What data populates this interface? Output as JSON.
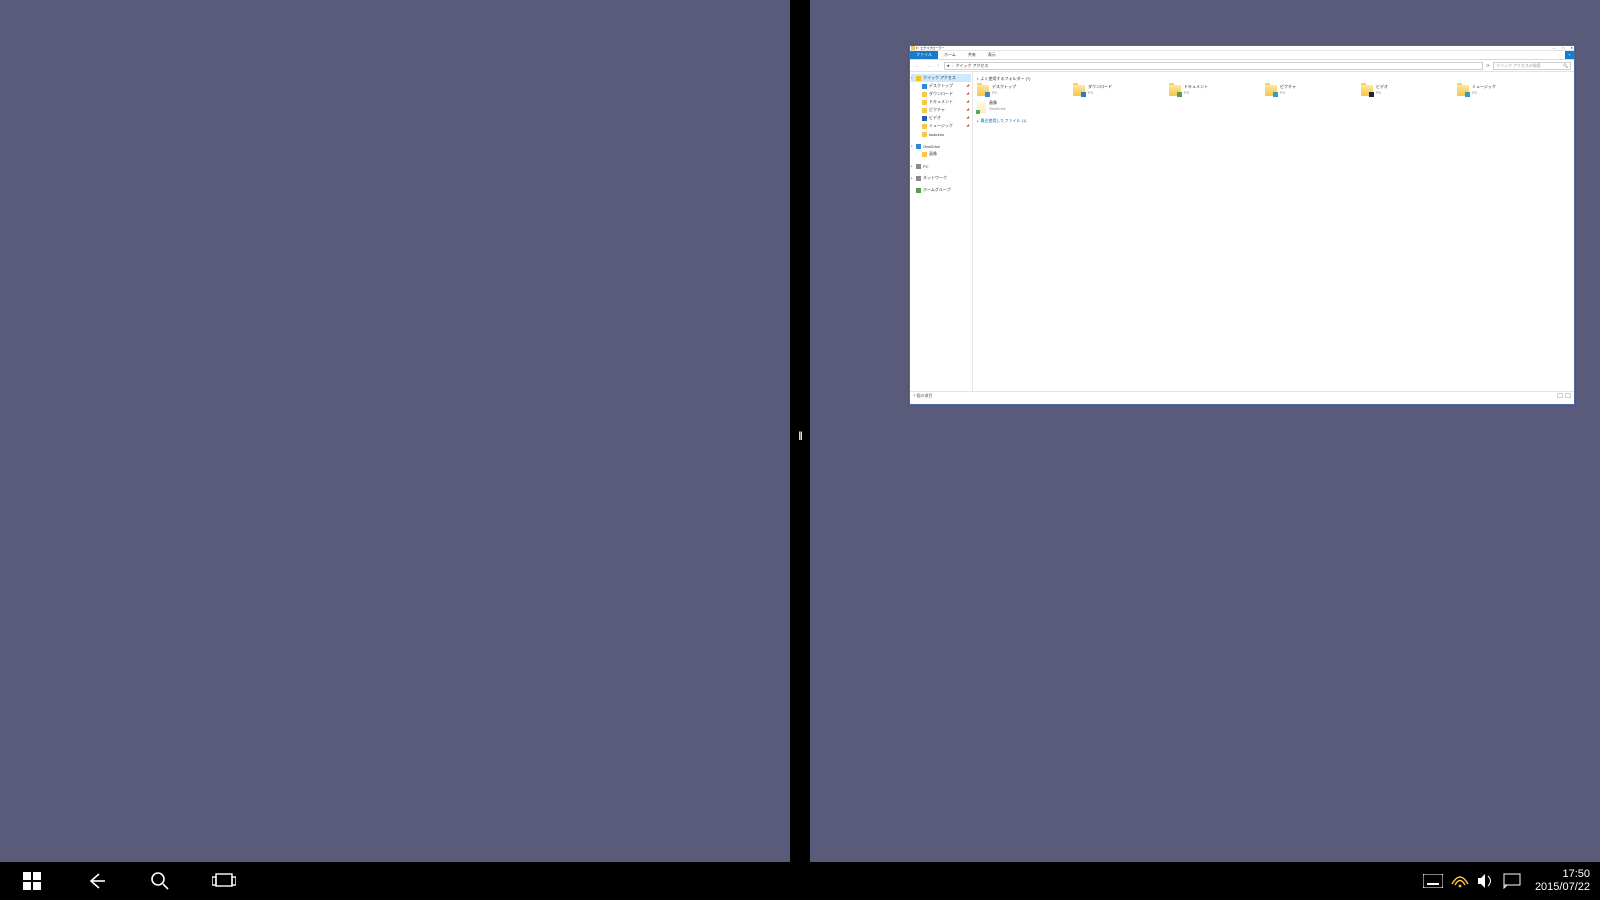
{
  "window": {
    "title": "エクスプローラー",
    "ribbon_tabs": {
      "file": "ファイル",
      "home": "ホーム",
      "share": "共有",
      "view": "表示"
    },
    "address": {
      "current": "クイック アクセス",
      "search_placeholder": "クイック アクセスの検索"
    },
    "nav": {
      "quick_access": "クイック アクセス",
      "desktop": "デスクトップ",
      "downloads": "ダウンロード",
      "documents": "ドキュメント",
      "pictures": "ピクチャ",
      "videos": "ビデオ",
      "music": "ミュージック",
      "tsukumo": "tsukumo",
      "onedrive": "OneDrive",
      "onedrive_pics": "画像",
      "pc": "PC",
      "network": "ネットワーク",
      "homegroup": "ホームグループ"
    },
    "group_freq": "よく使用するフォルダー (7)",
    "group_recent": "最近使用したファイル (1)",
    "folders": [
      {
        "name": "デスクトップ",
        "loc": "PC"
      },
      {
        "name": "ダウンロード",
        "loc": "PC"
      },
      {
        "name": "ドキュメント",
        "loc": "PC"
      },
      {
        "name": "ピクチャ",
        "loc": "PC"
      },
      {
        "name": "ビデオ",
        "loc": "PC"
      },
      {
        "name": "ミュージック",
        "loc": "PC"
      },
      {
        "name": "画像",
        "loc": "OneDrive"
      }
    ],
    "status": "7 個の項目"
  },
  "taskbar": {
    "time": "17:50",
    "date": "2015/07/22"
  }
}
